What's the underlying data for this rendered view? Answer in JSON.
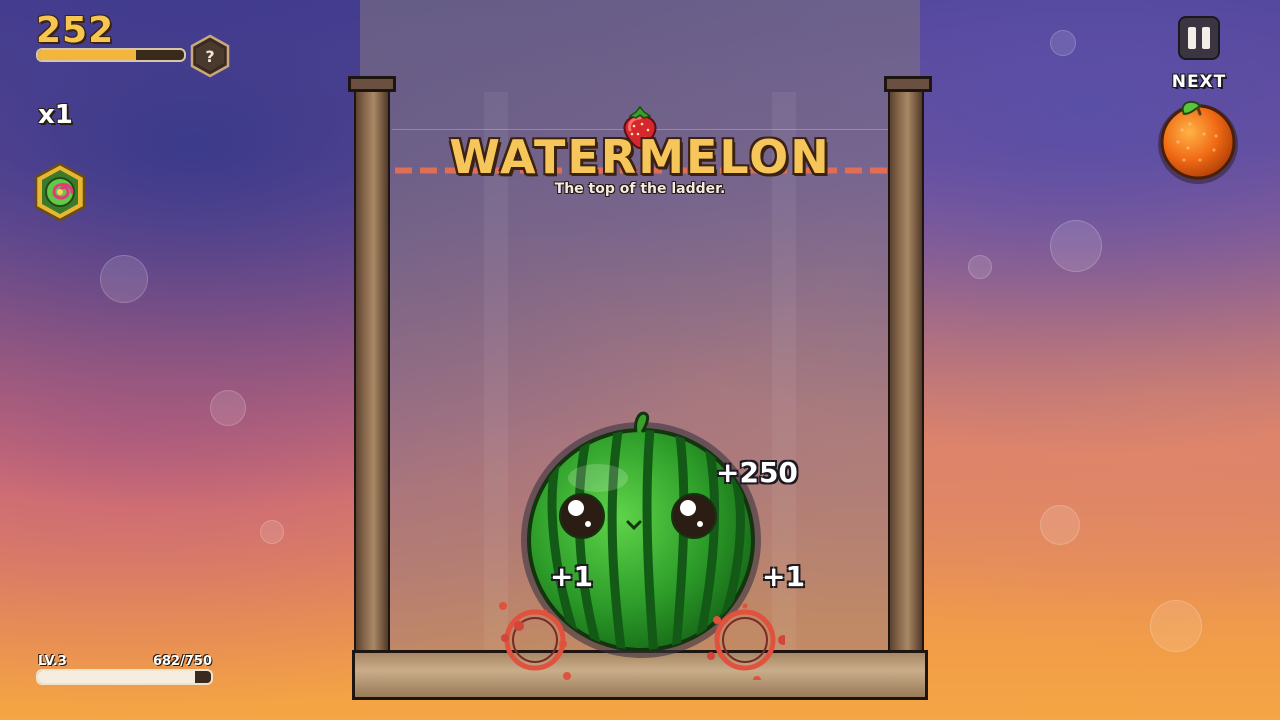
{
  "hud": {
    "score": "252",
    "score_progress": 0.67,
    "mystery_badge": "?",
    "multiplier": "x1",
    "powerup_icon": "swirl-candy-icon"
  },
  "level": {
    "label": "LV.3",
    "progress_text": "682/750",
    "current": 682,
    "max": 750
  },
  "next": {
    "label": "NEXT",
    "fruit_icon": "orange-icon"
  },
  "announcement": {
    "title": "WATERMELON",
    "subtitle": "The top of the ladder."
  },
  "points_popups": [
    {
      "text": "+250"
    },
    {
      "text": "+1"
    },
    {
      "text": "+1"
    }
  ],
  "colors": {
    "title_gold": "#f7c65a",
    "score_gold": "#f6c651",
    "danger_line": "#e06d55",
    "watermelon_green": "#2e9e2a"
  }
}
